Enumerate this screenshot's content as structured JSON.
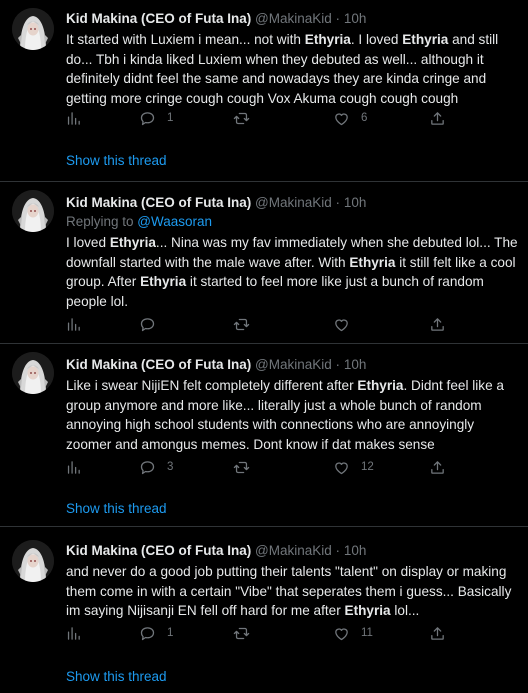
{
  "tweets": [
    {
      "name": "Kid Makina (CEO of Futa Ina)",
      "handle": "@MakinaKid",
      "sep": "·",
      "time": "10h",
      "reply_prefix": "",
      "reply_handle": "",
      "body": [
        {
          "t": "It started with Luxiem i mean... not with ",
          "b": false
        },
        {
          "t": "Ethyria",
          "b": true
        },
        {
          "t": ". I loved ",
          "b": false
        },
        {
          "t": "Ethyria",
          "b": true
        },
        {
          "t": " and still do... Tbh i kinda liked Luxiem when they debuted as well... although it definitely didnt feel the same and nowadays they are kinda cringe and getting more cringe cough cough Vox Akuma cough cough cough",
          "b": false
        }
      ],
      "counts": {
        "reply": "1",
        "retweet": "",
        "like": "6"
      },
      "show_thread": "Show this thread"
    },
    {
      "name": "Kid Makina (CEO of Futa Ina)",
      "handle": "@MakinaKid",
      "sep": "·",
      "time": "10h",
      "reply_prefix": "Replying to ",
      "reply_handle": "@Waasoran",
      "body": [
        {
          "t": "I loved ",
          "b": false
        },
        {
          "t": "Ethyria",
          "b": true
        },
        {
          "t": "... Nina was my fav immediately when she debuted lol... The downfall started with the male wave after. With ",
          "b": false
        },
        {
          "t": "Ethyria",
          "b": true
        },
        {
          "t": " it still felt like a cool group. After ",
          "b": false
        },
        {
          "t": "Ethyria",
          "b": true
        },
        {
          "t": " it started to feel more like just a bunch of random people lol.",
          "b": false
        }
      ],
      "counts": {
        "reply": "",
        "retweet": "",
        "like": ""
      },
      "show_thread": ""
    },
    {
      "name": "Kid Makina (CEO of Futa Ina)",
      "handle": "@MakinaKid",
      "sep": "·",
      "time": "10h",
      "reply_prefix": "",
      "reply_handle": "",
      "body": [
        {
          "t": "Like i swear NijiEN felt completely different after ",
          "b": false
        },
        {
          "t": "Ethyria",
          "b": true
        },
        {
          "t": ". Didnt feel like a group anymore and more like... literally just a whole bunch of random annoying high school students with connections who are annoyingly zoomer and amongus memes. Dont know if dat makes sense",
          "b": false
        }
      ],
      "counts": {
        "reply": "3",
        "retweet": "",
        "like": "12"
      },
      "show_thread": "Show this thread"
    },
    {
      "name": "Kid Makina (CEO of Futa Ina)",
      "handle": "@MakinaKid",
      "sep": "·",
      "time": "10h",
      "reply_prefix": "",
      "reply_handle": "",
      "body": [
        {
          "t": "and never do a good job putting their talents \"talent\" on display or making them come in with a certain \"Vibe\" that seperates them i guess... Basically im saying Nijisanji EN fell off hard for me after ",
          "b": false
        },
        {
          "t": "Ethyria",
          "b": true
        },
        {
          "t": " lol...",
          "b": false
        }
      ],
      "counts": {
        "reply": "1",
        "retweet": "",
        "like": "11"
      },
      "show_thread": "Show this thread"
    }
  ],
  "icons": {
    "analytics": "analytics-icon",
    "reply": "reply-icon",
    "retweet": "retweet-icon",
    "like": "like-icon",
    "share": "share-icon"
  },
  "colors": {
    "background": "#000000",
    "text": "#e7e9ea",
    "muted": "#71767b",
    "link": "#1d9bf0",
    "divider": "#2f3336"
  }
}
